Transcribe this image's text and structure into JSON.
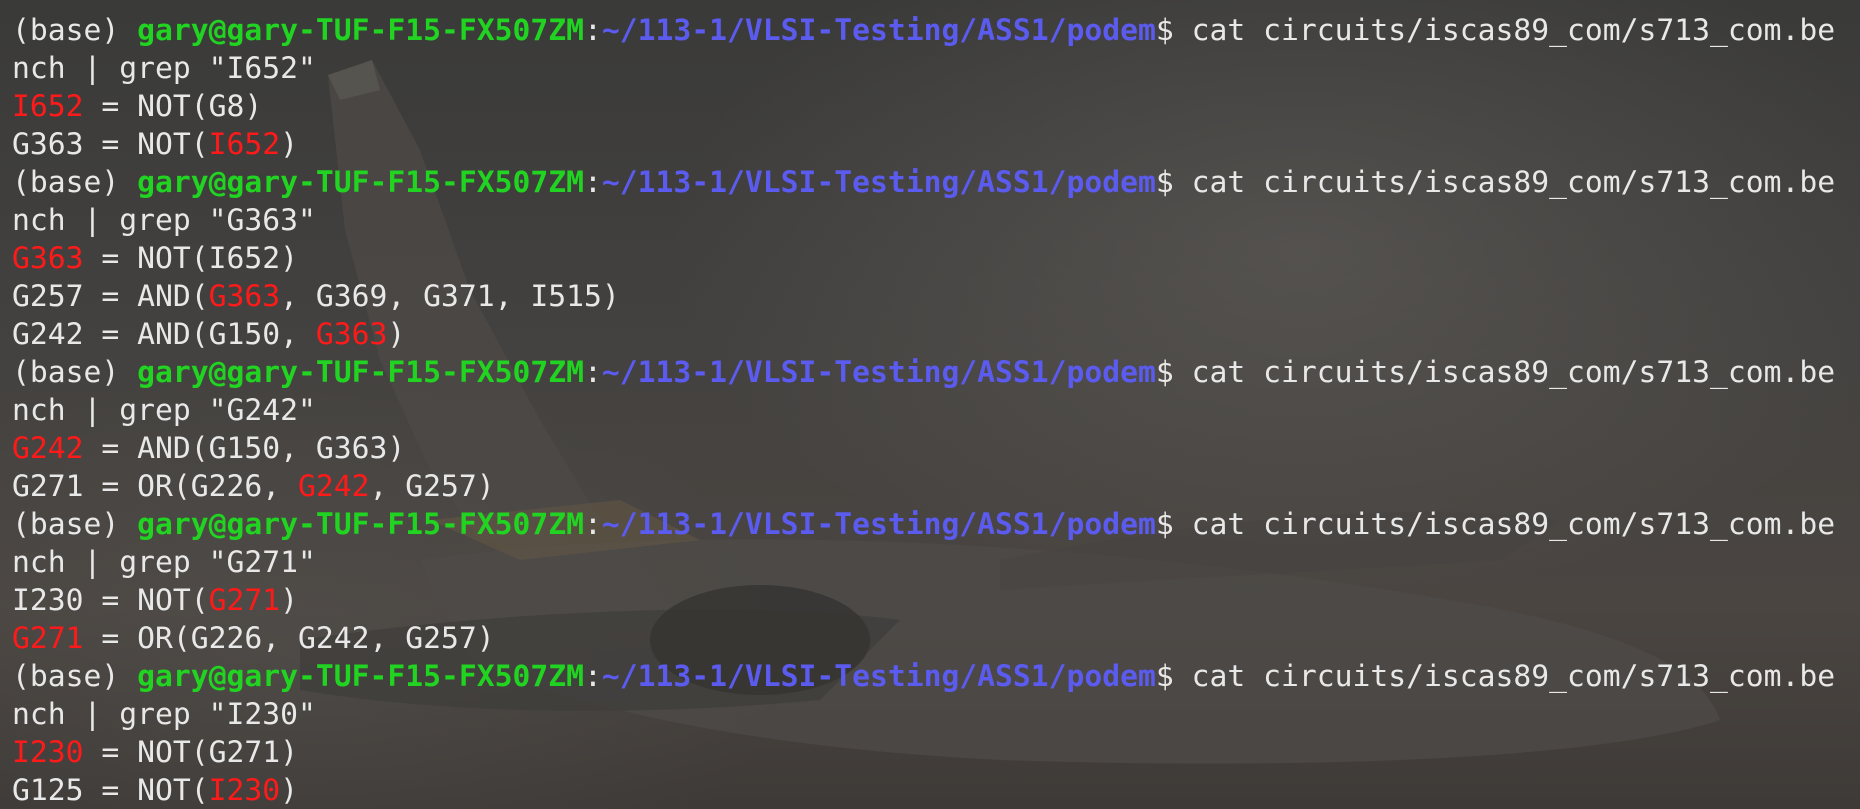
{
  "window": {
    "prompt": {
      "env": "(base) ",
      "user_host": "gary@gary-TUF-F15-FX507ZM",
      "colon": ":",
      "path": "~/113-1/VLSI-Testing/ASS1/podem",
      "dollar": "$ "
    },
    "colors": {
      "user_host": "#21d421",
      "path": "#5b5bf0",
      "highlight": "#ff1a1a",
      "text": "#e8e8e8"
    },
    "blocks": [
      {
        "cmd_line1": "cat circuits/iscas89_com/s713_com.be",
        "cmd_line2": "nch | grep \"I652\"",
        "results": [
          {
            "segments": [
              {
                "text": "I652",
                "hl": true
              },
              {
                "text": " = NOT(G8)",
                "hl": false
              }
            ]
          },
          {
            "segments": [
              {
                "text": "G363 = NOT(",
                "hl": false
              },
              {
                "text": "I652",
                "hl": true
              },
              {
                "text": ")",
                "hl": false
              }
            ]
          }
        ]
      },
      {
        "cmd_line1": "cat circuits/iscas89_com/s713_com.be",
        "cmd_line2": "nch | grep \"G363\"",
        "results": [
          {
            "segments": [
              {
                "text": "G363",
                "hl": true
              },
              {
                "text": " = NOT(I652)",
                "hl": false
              }
            ]
          },
          {
            "segments": [
              {
                "text": "G257 = AND(",
                "hl": false
              },
              {
                "text": "G363",
                "hl": true
              },
              {
                "text": ", G369, G371, I515)",
                "hl": false
              }
            ]
          },
          {
            "segments": [
              {
                "text": "G242 = AND(G150, ",
                "hl": false
              },
              {
                "text": "G363",
                "hl": true
              },
              {
                "text": ")",
                "hl": false
              }
            ]
          }
        ]
      },
      {
        "cmd_line1": "cat circuits/iscas89_com/s713_com.be",
        "cmd_line2": "nch | grep \"G242\"",
        "results": [
          {
            "segments": [
              {
                "text": "G242",
                "hl": true
              },
              {
                "text": " = AND(G150, G363)",
                "hl": false
              }
            ]
          },
          {
            "segments": [
              {
                "text": "G271 = OR(G226, ",
                "hl": false
              },
              {
                "text": "G242",
                "hl": true
              },
              {
                "text": ", G257)",
                "hl": false
              }
            ]
          }
        ]
      },
      {
        "cmd_line1": "cat circuits/iscas89_com/s713_com.be",
        "cmd_line2": "nch | grep \"G271\"",
        "results": [
          {
            "segments": [
              {
                "text": "I230 = NOT(",
                "hl": false
              },
              {
                "text": "G271",
                "hl": true
              },
              {
                "text": ")",
                "hl": false
              }
            ]
          },
          {
            "segments": [
              {
                "text": "G271",
                "hl": true
              },
              {
                "text": " = OR(G226, G242, G257)",
                "hl": false
              }
            ]
          }
        ]
      },
      {
        "cmd_line1": "cat circuits/iscas89_com/s713_com.be",
        "cmd_line2": "nch | grep \"I230\"",
        "results": [
          {
            "segments": [
              {
                "text": "I230",
                "hl": true
              },
              {
                "text": " = NOT(G271)",
                "hl": false
              }
            ]
          },
          {
            "segments": [
              {
                "text": "G125 = NOT(",
                "hl": false
              },
              {
                "text": "I230",
                "hl": true
              },
              {
                "text": ")",
                "hl": false
              }
            ]
          }
        ]
      }
    ]
  }
}
